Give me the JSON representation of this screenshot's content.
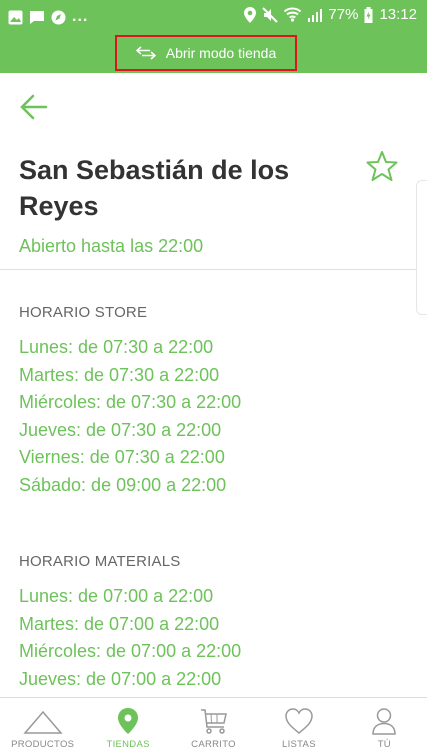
{
  "status_bar": {
    "battery": "77%",
    "time": "13:12",
    "more": "..."
  },
  "store_mode": {
    "label": "Abrir modo tienda"
  },
  "store": {
    "name": "San Sebastián de los Reyes",
    "open_status": "Abierto hasta las 22:00"
  },
  "schedules": [
    {
      "title": "HORARIO STORE",
      "days": [
        "Lunes: de 07:30 a 22:00",
        "Martes: de 07:30 a 22:00",
        "Miércoles: de 07:30 a 22:00",
        "Jueves: de 07:30 a 22:00",
        "Viernes: de 07:30 a 22:00",
        "Sábado: de 09:00 a 22:00"
      ]
    },
    {
      "title": "HORARIO MATERIALS",
      "days": [
        "Lunes: de 07:00 a 22:00",
        "Martes: de 07:00 a 22:00",
        "Miércoles: de 07:00 a 22:00",
        "Jueves: de 07:00 a 22:00"
      ]
    }
  ],
  "bottom_nav": [
    {
      "label": "PRODUCTOS",
      "icon": "triangle-icon",
      "active": false
    },
    {
      "label": "TIENDAS",
      "icon": "map-pin-icon",
      "active": true
    },
    {
      "label": "CARRITO",
      "icon": "cart-icon",
      "active": false
    },
    {
      "label": "LISTAS",
      "icon": "heart-icon",
      "active": false
    },
    {
      "label": "TÚ",
      "icon": "user-icon",
      "active": false
    }
  ],
  "colors": {
    "brand_green": "#6dc25a",
    "highlight_red": "#e0141e"
  }
}
